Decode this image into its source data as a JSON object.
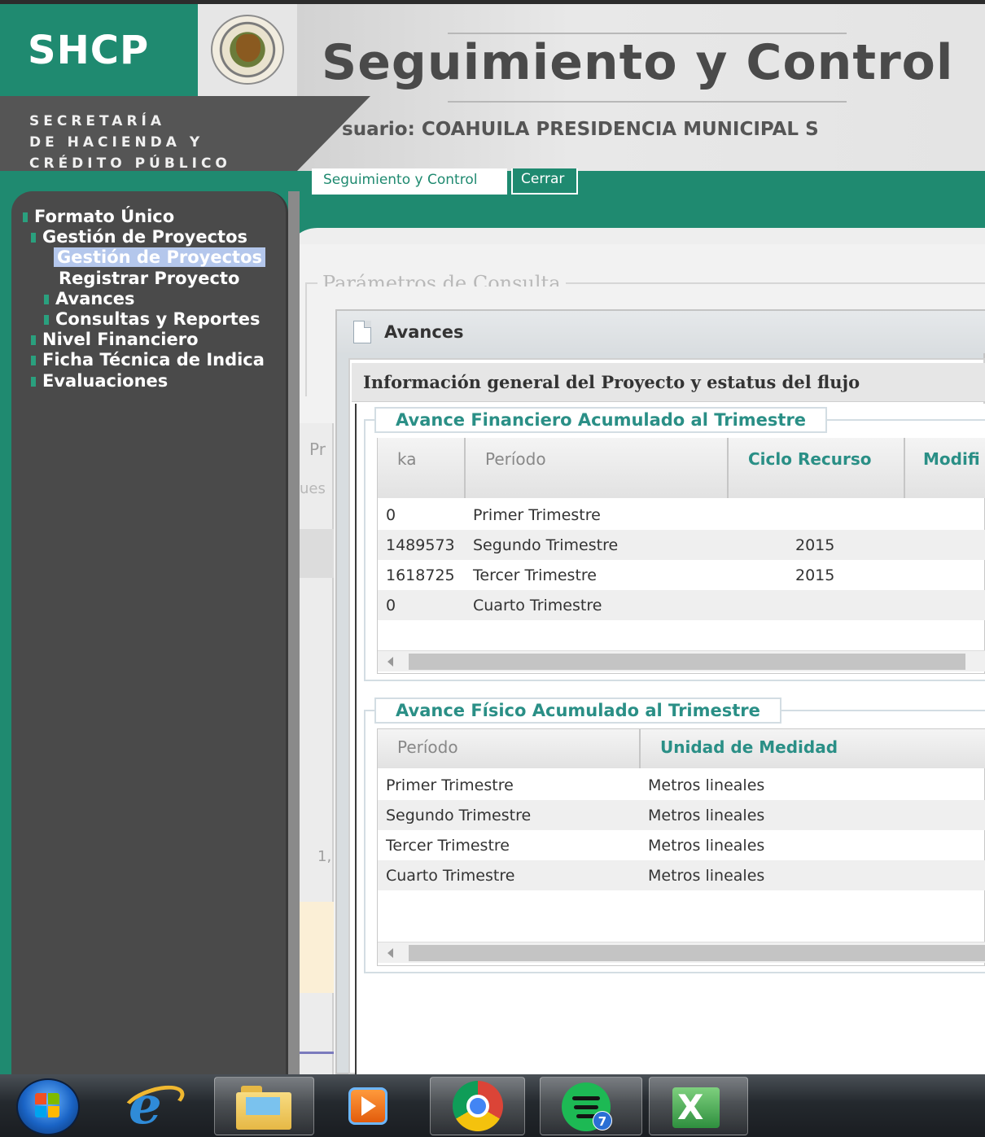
{
  "header": {
    "logo_text": "SHCP",
    "seal_icon": "mexico-coat-of-arms-icon",
    "secretaria_lines": [
      "SECRETARÍA",
      "DE HACIENDA Y",
      "CRÉDITO PÚBLICO"
    ],
    "app_title": "Seguimiento y Control",
    "user_line": "suario: COAHUILA PRESIDENCIA MUNICIPAL S",
    "tabs": [
      {
        "label": "Seguimiento y Control"
      },
      {
        "label": "Cerrar"
      }
    ],
    "colors": {
      "brand_teal": "#1f8a70",
      "dark_gray": "#555555"
    }
  },
  "sidebar": {
    "items": [
      {
        "label": "Formato Único"
      },
      {
        "label": "Gestión de Proyectos"
      },
      {
        "label": "Gestión de Proyectos",
        "selected": true
      },
      {
        "label": "Registrar Proyecto"
      },
      {
        "label": "Avances"
      },
      {
        "label": "Consultas y Reportes"
      },
      {
        "label": "Nivel Financiero"
      },
      {
        "label": "Ficha Técnica de Indica"
      },
      {
        "label": "Evaluaciones"
      }
    ]
  },
  "background": {
    "legend": "Parámetros de Consulta",
    "strip_pr": "Pr",
    "strip_ues": "ues",
    "strip_num": "1,"
  },
  "window": {
    "title": "Avances",
    "icon": "document-icon",
    "info_title": "Información general del Proyecto y estatus del flujo",
    "financiero": {
      "legend": "Avance Financiero Acumulado al Trimestre",
      "columns": [
        "ka",
        "Período",
        "Ciclo Recurso",
        "Modifi"
      ],
      "rows": [
        {
          "ka": "0",
          "periodo": "Primer Trimestre",
          "ciclo": ""
        },
        {
          "ka": "1489573",
          "periodo": "Segundo Trimestre",
          "ciclo": "2015"
        },
        {
          "ka": "1618725",
          "periodo": "Tercer Trimestre",
          "ciclo": "2015"
        },
        {
          "ka": "0",
          "periodo": "Cuarto Trimestre",
          "ciclo": ""
        }
      ]
    },
    "fisico": {
      "legend": "Avance Físico Acumulado al Trimestre",
      "columns": [
        "Período",
        "Unidad de Medidad"
      ],
      "rows": [
        {
          "periodo": "Primer Trimestre",
          "unidad": "Metros lineales"
        },
        {
          "periodo": "Segundo Trimestre",
          "unidad": "Metros lineales"
        },
        {
          "periodo": "Tercer Trimestre",
          "unidad": "Metros lineales"
        },
        {
          "periodo": "Cuarto Trimestre",
          "unidad": "Metros lineales"
        }
      ]
    }
  },
  "taskbar": {
    "items": [
      {
        "icon": "windows-start-icon"
      },
      {
        "icon": "internet-explorer-icon"
      },
      {
        "icon": "file-explorer-icon"
      },
      {
        "icon": "media-player-icon"
      },
      {
        "icon": "chrome-icon",
        "active": true
      },
      {
        "icon": "spotify-icon",
        "badge": "7"
      },
      {
        "icon": "excel-icon"
      }
    ]
  }
}
